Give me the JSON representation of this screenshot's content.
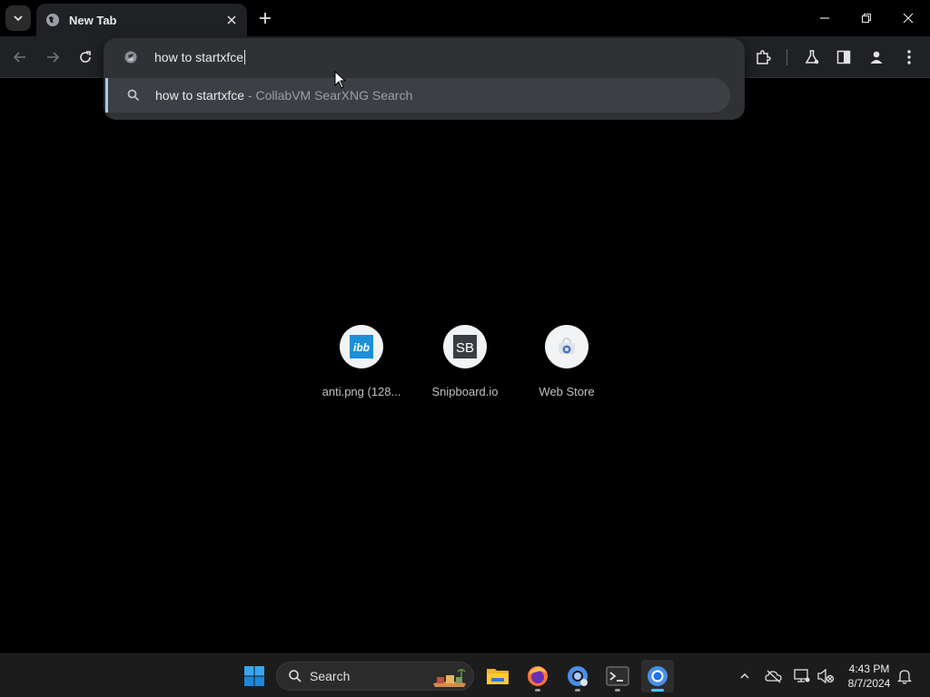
{
  "browser": {
    "tab": {
      "title": "New Tab",
      "favicon": "globe-icon"
    },
    "omnibox": {
      "value": "how to startxfce",
      "suggestion": {
        "query": "how to startxfce",
        "separator": " - ",
        "description": "CollabVM SearXNG Search"
      }
    },
    "shortcuts": [
      {
        "label": "anti.png (128...",
        "icon": "ibb-icon"
      },
      {
        "label": "Snipboard.io",
        "icon": "snipboard-icon"
      },
      {
        "label": "Web Store",
        "icon": "webstore-icon"
      }
    ],
    "shortcut_glyphs": {
      "ibb": "ibb",
      "snipboard": "SB"
    }
  },
  "taskbar": {
    "search_label": "Search",
    "time": "4:43 PM",
    "date": "8/7/2024"
  },
  "colors": {
    "page_bg": "#000000",
    "toolbar_bg": "#202124",
    "omnibox_bg": "#303134",
    "accent": "#a8c7fa",
    "taskbar_bg": "#1c1c1c"
  }
}
